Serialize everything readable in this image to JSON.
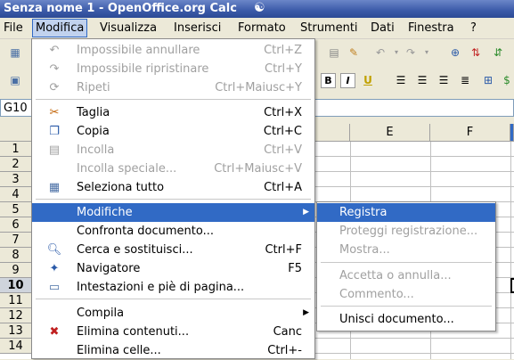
{
  "window": {
    "title": "Senza nome 1 - OpenOffice.org Calc",
    "app_icon": "openoffice-gull-icon"
  },
  "menubar": {
    "items": [
      "File",
      "Modifica",
      "Visualizza",
      "Inserisci",
      "Formato",
      "Strumenti",
      "Dati",
      "Finestra",
      "?"
    ],
    "active": "Modifica"
  },
  "namebox": {
    "value": "G10"
  },
  "sheet": {
    "columns": [
      "E",
      "F"
    ],
    "rows": [
      "1",
      "2",
      "3",
      "4",
      "5",
      "6",
      "7",
      "8",
      "9",
      "10",
      "11",
      "12",
      "13",
      "14"
    ],
    "selected_row": "10"
  },
  "menu": {
    "items": [
      {
        "label": "Impossibile annullare",
        "shortcut": "Ctrl+Z",
        "enabled": false,
        "icon": "undo-icon"
      },
      {
        "label": "Impossibile ripristinare",
        "shortcut": "Ctrl+Y",
        "enabled": false,
        "icon": "redo-icon"
      },
      {
        "label": "Ripeti",
        "shortcut": "Ctrl+Maiusc+Y",
        "enabled": false,
        "icon": "repeat-icon"
      },
      {
        "label": "Taglia",
        "shortcut": "Ctrl+X",
        "enabled": true,
        "icon": "scissors-icon"
      },
      {
        "label": "Copia",
        "shortcut": "Ctrl+C",
        "enabled": true,
        "icon": "copy-icon"
      },
      {
        "label": "Incolla",
        "shortcut": "Ctrl+V",
        "enabled": false,
        "icon": "paste-icon"
      },
      {
        "label": "Incolla speciale...",
        "shortcut": "Ctrl+Maiusc+V",
        "enabled": false,
        "icon": ""
      },
      {
        "label": "Seleziona tutto",
        "shortcut": "Ctrl+A",
        "enabled": true,
        "icon": "select-all-icon"
      },
      {
        "label": "Modifiche",
        "shortcut": "",
        "enabled": true,
        "submenu": true,
        "highlighted": true,
        "icon": ""
      },
      {
        "label": "Confronta documento...",
        "shortcut": "",
        "enabled": true,
        "icon": ""
      },
      {
        "label": "Cerca e sostituisci...",
        "shortcut": "Ctrl+F",
        "enabled": true,
        "icon": "find-replace-icon"
      },
      {
        "label": "Navigatore",
        "shortcut": "F5",
        "enabled": true,
        "icon": "navigator-icon"
      },
      {
        "label": "Intestazioni e piè di pagina...",
        "shortcut": "",
        "enabled": true,
        "icon": "header-footer-icon"
      },
      {
        "label": "Compila",
        "shortcut": "",
        "enabled": true,
        "submenu": true,
        "icon": ""
      },
      {
        "label": "Elimina contenuti...",
        "shortcut": "Canc",
        "enabled": true,
        "icon": "delete-contents-icon"
      },
      {
        "label": "Elimina celle...",
        "shortcut": "Ctrl+-",
        "enabled": true,
        "icon": ""
      }
    ]
  },
  "submenu": {
    "items": [
      {
        "label": "Registra",
        "enabled": true,
        "highlighted": true
      },
      {
        "label": "Proteggi registrazione...",
        "enabled": false
      },
      {
        "label": "Mostra...",
        "enabled": false
      },
      {
        "label": "Accetta o annulla...",
        "enabled": false
      },
      {
        "label": "Commento...",
        "enabled": false
      },
      {
        "label": "Unisci documento...",
        "enabled": true
      }
    ]
  },
  "format_toolbar": {
    "bold": "B",
    "italic": "I"
  }
}
